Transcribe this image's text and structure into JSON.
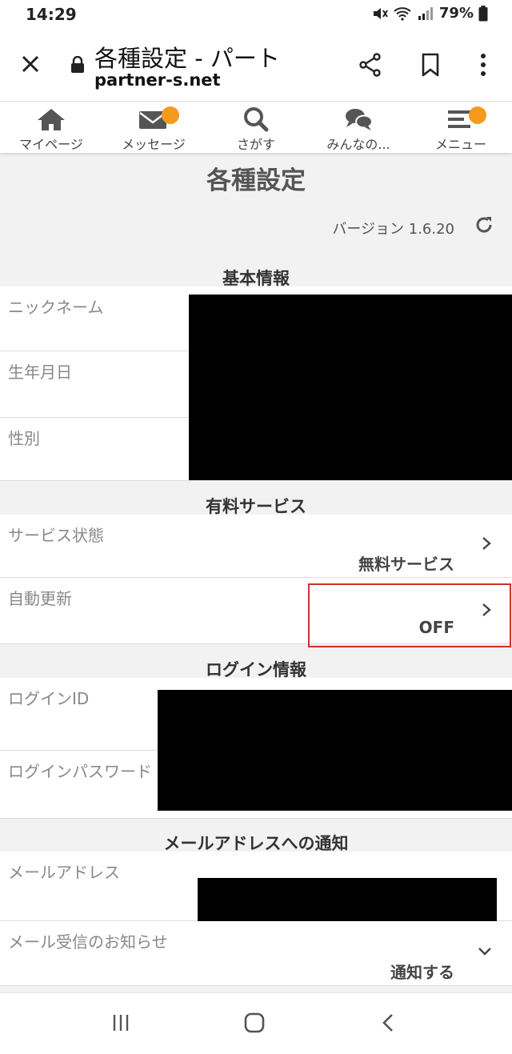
{
  "status": {
    "time": "14:29",
    "battery": "79%"
  },
  "browser": {
    "title": "各種設定 - パート",
    "domain": "partner-s.net"
  },
  "nav": [
    {
      "label": "マイページ",
      "icon": "home-icon"
    },
    {
      "label": "メッセージ",
      "icon": "mail-icon"
    },
    {
      "label": "さがす",
      "icon": "search-icon"
    },
    {
      "label": "みんなの...",
      "icon": "chat-icon"
    },
    {
      "label": "メニュー",
      "icon": "menu-icon"
    }
  ],
  "page": {
    "heading": "各種設定",
    "version": "バージョン 1.6.20"
  },
  "basic": {
    "title": "基本情報",
    "nickname_label": "ニックネーム",
    "birthday_label": "生年月日",
    "gender_label": "性別"
  },
  "paid": {
    "title": "有料サービス",
    "status_label": "サービス状態",
    "status_value": "無料サービス",
    "auto_label": "自動更新",
    "auto_value": "OFF"
  },
  "login": {
    "title": "ログイン情報",
    "id_label": "ログインID",
    "password_label": "ログインパスワード"
  },
  "mail": {
    "title": "メールアドレスへの通知",
    "address_label": "メールアドレス",
    "notify_label": "メール受信のお知らせ",
    "notify_value": "通知する"
  },
  "colors": {
    "badge": "#f59a1b",
    "highlight": "#d0312d"
  }
}
